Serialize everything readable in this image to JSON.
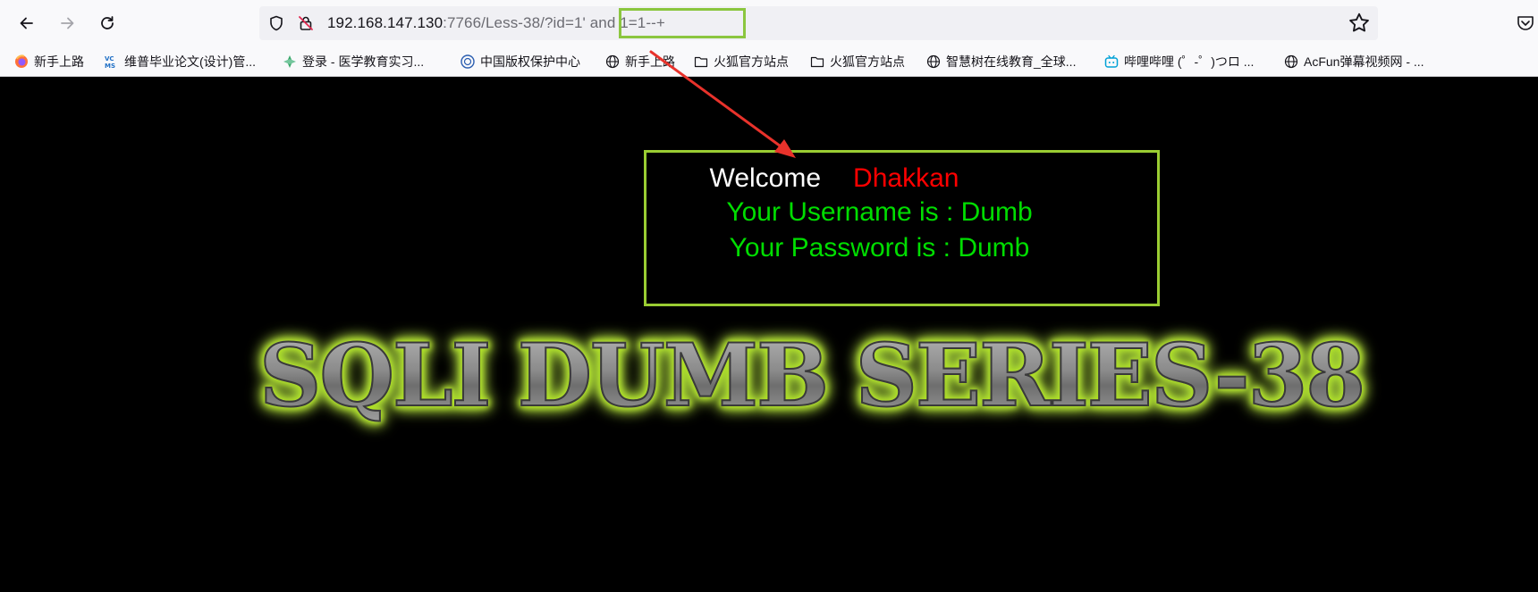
{
  "browser": {
    "url": {
      "host": "192.168.147.130",
      "rest": ":7766/Less-38/?id=1' and 1=1--+"
    },
    "icons": {
      "back": "arrow-left-icon",
      "forward": "arrow-right-icon",
      "reload": "reload-icon",
      "shield": "shield-icon",
      "insecure": "insecure-lock-icon",
      "bookmark_star": "star-icon",
      "pocket": "pocket-icon"
    }
  },
  "bookmarks": [
    {
      "label": "新手上路",
      "icon": "firefox-icon"
    },
    {
      "label": "维普毕业论文(设计)管...",
      "icon": "vcms-icon"
    },
    {
      "label": "登录 - 医学教育实习...",
      "icon": "green-leaf-icon"
    },
    {
      "label": "中国版权保护中心",
      "icon": "copyright-center-icon"
    },
    {
      "label": "新手上路",
      "icon": "globe-icon"
    },
    {
      "label": "火狐官方站点",
      "icon": "folder-icon"
    },
    {
      "label": "火狐官方站点",
      "icon": "folder-icon"
    },
    {
      "label": "智慧树在线教育_全球...",
      "icon": "globe-icon"
    },
    {
      "label": "哔哩哔哩 (゜-゜)つロ ...",
      "icon": "bilibili-icon"
    },
    {
      "label": "AcFun弹幕视频网 - ...",
      "icon": "globe-icon"
    }
  ],
  "page": {
    "welcome_word": "Welcome",
    "welcome_name": "Dhakkan",
    "username_line": "Your Username is : Dumb",
    "password_line": "Your Password is : Dumb",
    "series_title": "SQLI DUMB SERIES-38"
  },
  "colors": {
    "highlight": "#8bc63f",
    "arrow": "#e8322b",
    "box_border": "#9acd32",
    "info_text": "#00dd00",
    "welcome_name": "#ff0000"
  }
}
